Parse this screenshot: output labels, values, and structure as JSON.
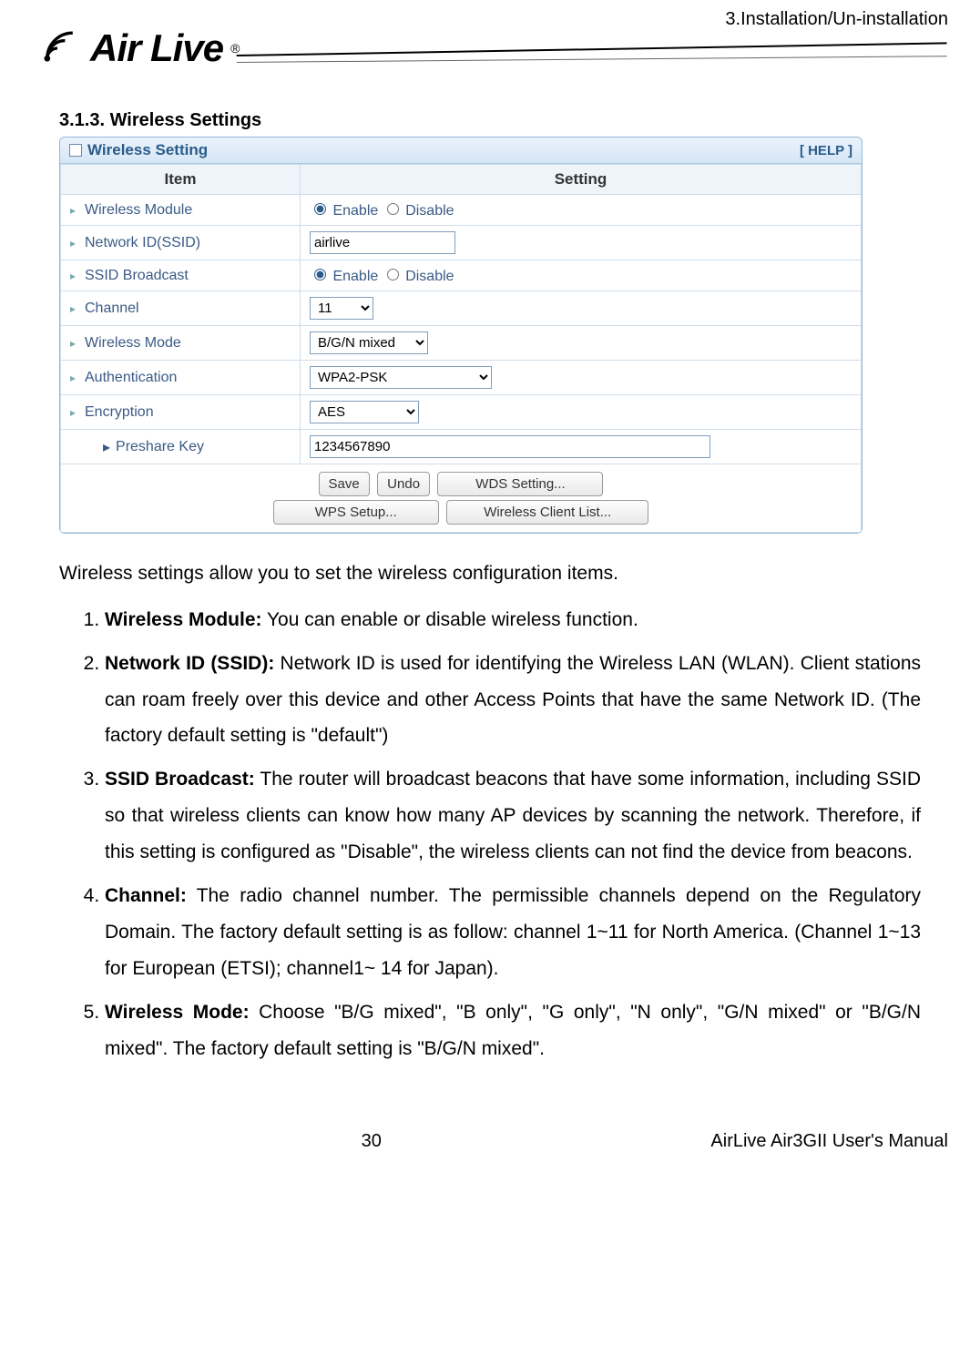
{
  "header": {
    "chapter": "3.Installation/Un-installation",
    "brand": "Air Live",
    "reg": "®"
  },
  "section": {
    "number": "3.1.3.",
    "title": "Wireless Settings"
  },
  "panel": {
    "title": "Wireless Setting",
    "help": "[ HELP ]",
    "cols": {
      "item": "Item",
      "setting": "Setting"
    },
    "rows": {
      "module": {
        "label": "Wireless Module",
        "enable": "Enable",
        "disable": "Disable"
      },
      "ssid": {
        "label": "Network ID(SSID)",
        "value": "airlive"
      },
      "broad": {
        "label": "SSID Broadcast",
        "enable": "Enable",
        "disable": "Disable"
      },
      "channel": {
        "label": "Channel",
        "value": "11"
      },
      "mode": {
        "label": "Wireless Mode",
        "value": "B/G/N mixed"
      },
      "auth": {
        "label": "Authentication",
        "value": "WPA2-PSK"
      },
      "enc": {
        "label": "Encryption",
        "value": "AES"
      },
      "psk": {
        "label": "Preshare Key",
        "value": "1234567890"
      }
    },
    "buttons": {
      "save": "Save",
      "undo": "Undo",
      "wds": "WDS Setting...",
      "wps": "WPS Setup...",
      "clients": "Wireless Client List..."
    }
  },
  "body": {
    "intro": "Wireless settings allow you to set the wireless configuration items.",
    "li1_b": "Wireless Module:",
    "li1_t": " You can enable or disable wireless function.",
    "li2_b": "Network ID (SSID):",
    "li2_t": " Network ID is used for identifying the Wireless LAN (WLAN). Client stations can roam freely over this device and other Access Points that have the same Network ID. (The factory default setting is \"default\")",
    "li3_b": "SSID Broadcast:",
    "li3_t": " The router will broadcast beacons that have some information, including SSID so that wireless clients can know how many AP devices by scanning the network. Therefore, if this setting is configured as \"Disable\", the wireless clients can not find the device from beacons.",
    "li4_b": "Channel:",
    "li4_t": " The radio channel number. The permissible channels depend on the Regulatory Domain. The factory default setting is as follow: channel 1~11 for North America. (Channel 1~13 for European (ETSI); channel1~ 14 for Japan).",
    "li5_b": "Wireless Mode:",
    "li5_t": " Choose \"B/G mixed\", \"B only\", \"G only\", \"N only\", \"G/N mixed\" or \"B/G/N mixed\". The factory default setting is \"B/G/N mixed\"."
  },
  "footer": {
    "page": "30",
    "manual": "AirLive Air3GII User's Manual"
  }
}
